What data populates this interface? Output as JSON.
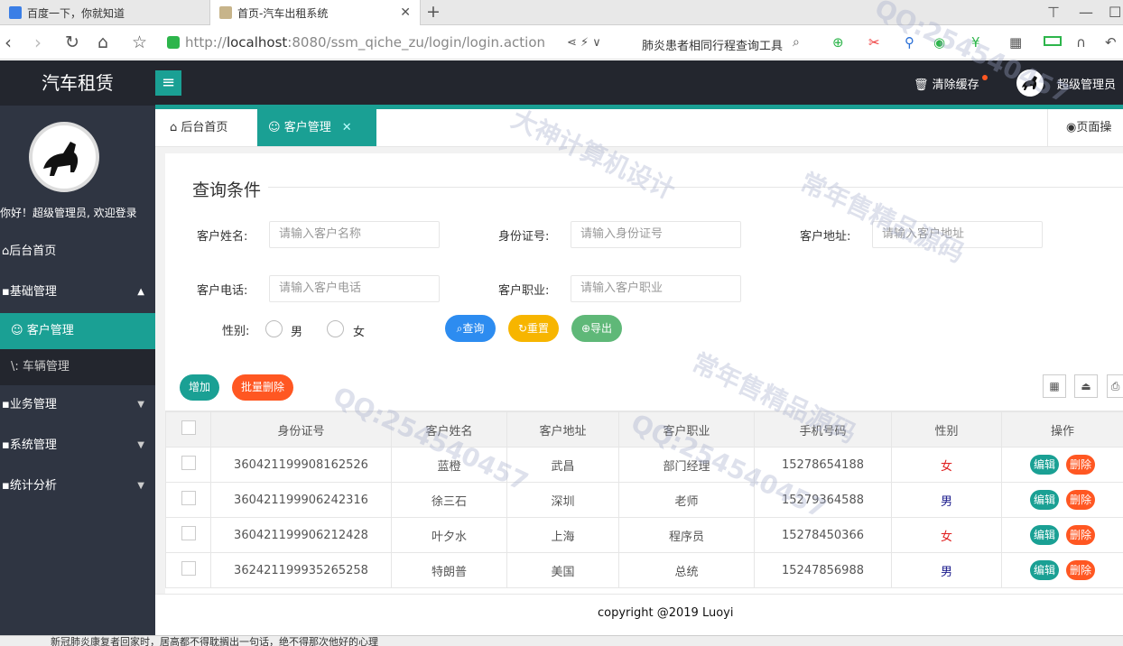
{
  "browser": {
    "tabs": [
      {
        "title": "百度一下，你就知道"
      },
      {
        "title": "首页-汽车出租系统"
      }
    ],
    "new_tab": "+",
    "url_prefix": "http://",
    "url_host": "localhost",
    "url_rest": ":8080/ssm_qiche_zu/login/login.action",
    "search_text": "肺炎患者相同行程查询工具"
  },
  "app": {
    "logo": "汽车租赁",
    "clear_cache": "清除缓存",
    "admin_name": "超级管理员",
    "welcome": "你好！超级管理员, 欢迎登录"
  },
  "sidebar": {
    "items": [
      {
        "label": "后台首页"
      },
      {
        "label": "基础管理"
      },
      {
        "label": "客户管理"
      },
      {
        "label": "车辆管理"
      },
      {
        "label": "业务管理"
      },
      {
        "label": "系统管理"
      },
      {
        "label": "统计分析"
      }
    ]
  },
  "page_tabs": [
    {
      "label": "后台首页"
    },
    {
      "label": "客户管理"
    }
  ],
  "page_op": "页面操",
  "query": {
    "title": "查询条件",
    "fields": [
      {
        "label": "客户姓名:",
        "placeholder": "请输入客户名称"
      },
      {
        "label": "身份证号:",
        "placeholder": "请输入身份证号"
      },
      {
        "label": "客户地址:",
        "placeholder": "请输入客户地址"
      },
      {
        "label": "客户电话:",
        "placeholder": "请输入客户电话"
      },
      {
        "label": "客户职业:",
        "placeholder": "请输入客户职业"
      }
    ],
    "gender_label": "性别:",
    "gender_options": [
      "男",
      "女"
    ],
    "buttons": {
      "search": "查询",
      "reset": "重置",
      "export": "导出"
    }
  },
  "toolbar": {
    "add": "增加",
    "batch_delete": "批量删除"
  },
  "table": {
    "headers": [
      "身份证号",
      "客户姓名",
      "客户地址",
      "客户职业",
      "手机号码",
      "性别",
      "操作"
    ],
    "rows": [
      [
        "360421199908162526",
        "蓝橙",
        "武昌",
        "部门经理",
        "15278654188",
        "女"
      ],
      [
        "360421199906242316",
        "徐三石",
        "深圳",
        "老师",
        "15279364588",
        "男"
      ],
      [
        "360421199906212428",
        "叶夕水",
        "上海",
        "程序员",
        "15278450366",
        "女"
      ],
      [
        "362421199935265258",
        "特朗普",
        "美国",
        "总统",
        "15247856988",
        "男"
      ]
    ],
    "edit": "编辑",
    "delete": "删除"
  },
  "footer": "copyright @2019 Luoyi",
  "status_text": "新冠肺炎康复者回家时，居高都不得耽搁出一句话，绝不得那次他好的心理",
  "colors": {
    "accent": "#1aa094",
    "sidebar": "#2f3542",
    "topbar": "#23262e",
    "female": "#e02020",
    "male": "#1a1a8c"
  }
}
